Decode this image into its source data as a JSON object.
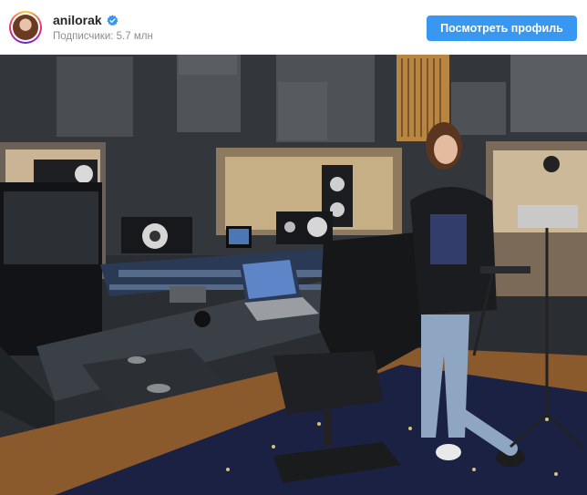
{
  "profile": {
    "username": "anilorak",
    "verified": true,
    "followers_label": "Подписчики: 5.7 млн",
    "button_label": "Посмотреть профиль"
  },
  "colors": {
    "accent": "#3897f0",
    "verified_badge": "#3897f0"
  },
  "icons": {
    "verified": "verified-badge-icon"
  }
}
